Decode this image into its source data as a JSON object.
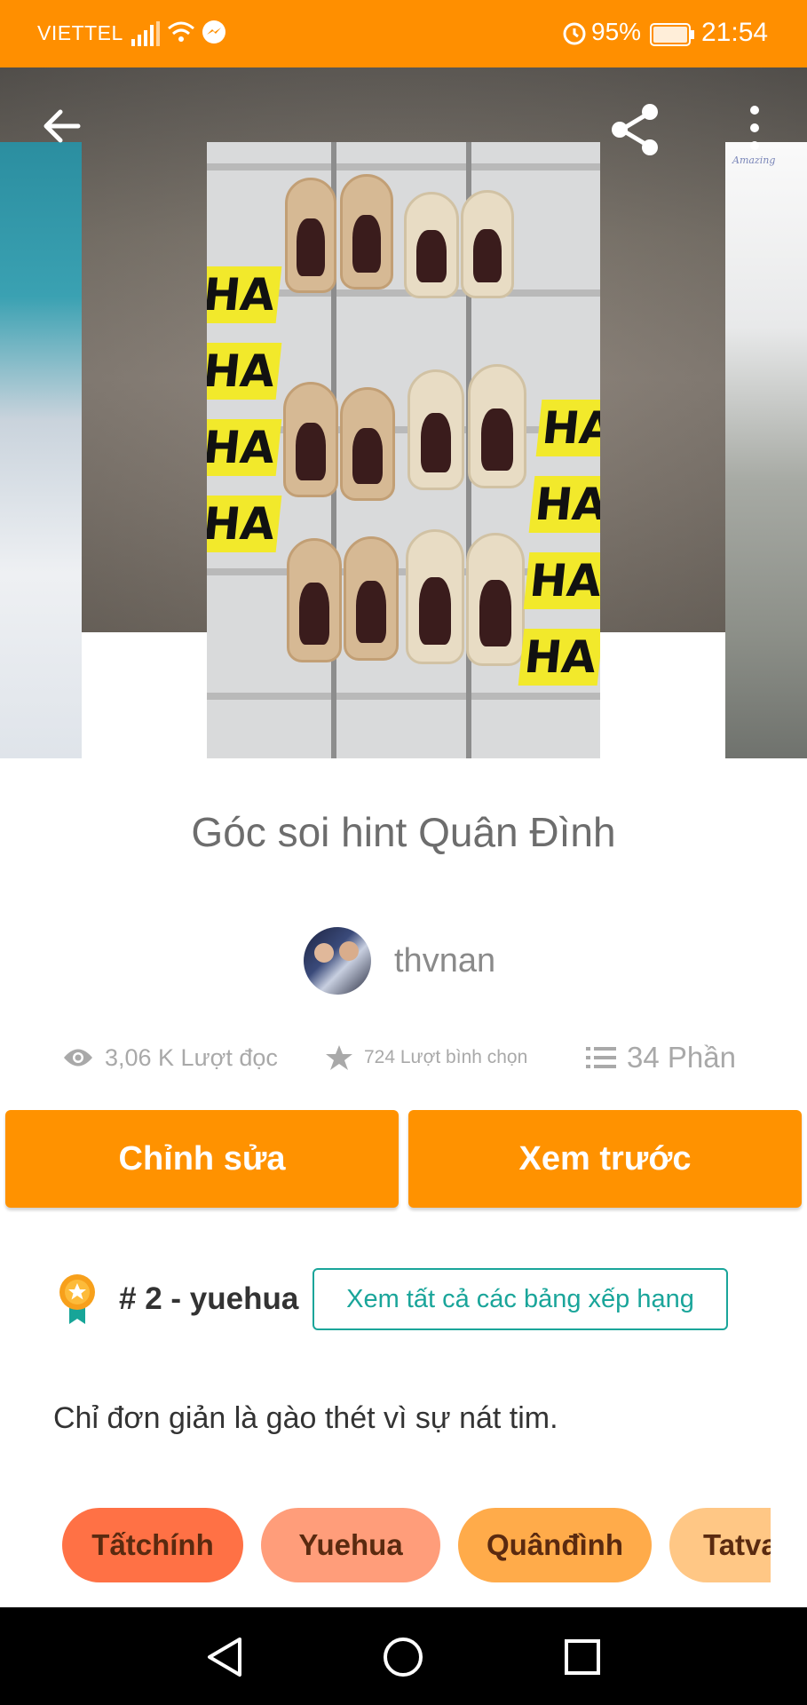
{
  "status_bar": {
    "carrier": "VIETTEL",
    "battery_percent": "95%",
    "time": "21:54",
    "icons": [
      "signal-icon",
      "wifi-icon",
      "messenger-icon",
      "alarm-icon",
      "battery-icon"
    ]
  },
  "hero": {
    "back_icon": "arrow-left-icon",
    "share_icon": "share-icon",
    "more_icon": "more-vertical-icon",
    "cover_text": [
      "HA",
      "HA",
      "HA",
      "HA",
      "HA",
      "HA",
      "HA",
      "HA"
    ]
  },
  "story": {
    "title": "Góc soi hint Quân Đình",
    "author": "thvnan",
    "description": "Chỉ đơn giản là gào thét vì sự nát tim."
  },
  "stats": {
    "reads": "3,06 K Lượt đọc",
    "votes": "724 Lượt bình chọn",
    "parts": "34 Phần"
  },
  "actions": {
    "edit_label": "Chỉnh sửa",
    "preview_label": "Xem trước"
  },
  "ranking": {
    "rank": "# 2 - yuehua",
    "see_all_label": "Xem tất cả các bảng xếp hạng"
  },
  "tags": [
    {
      "label": "Tấtchính",
      "color": "#ff7145"
    },
    {
      "label": "Yuehua",
      "color": "#ff9d7a"
    },
    {
      "label": "Quânđình",
      "color": "#ffab4a"
    },
    {
      "label": "Tatvan",
      "color": "#ffc785"
    }
  ],
  "colors": {
    "accent": "#ff9200",
    "status_bar": "#ff8f00",
    "teal": "#1aa59a"
  },
  "nav_bar": {
    "icons": [
      "back-triangle-icon",
      "home-circle-icon",
      "recents-square-icon"
    ]
  }
}
